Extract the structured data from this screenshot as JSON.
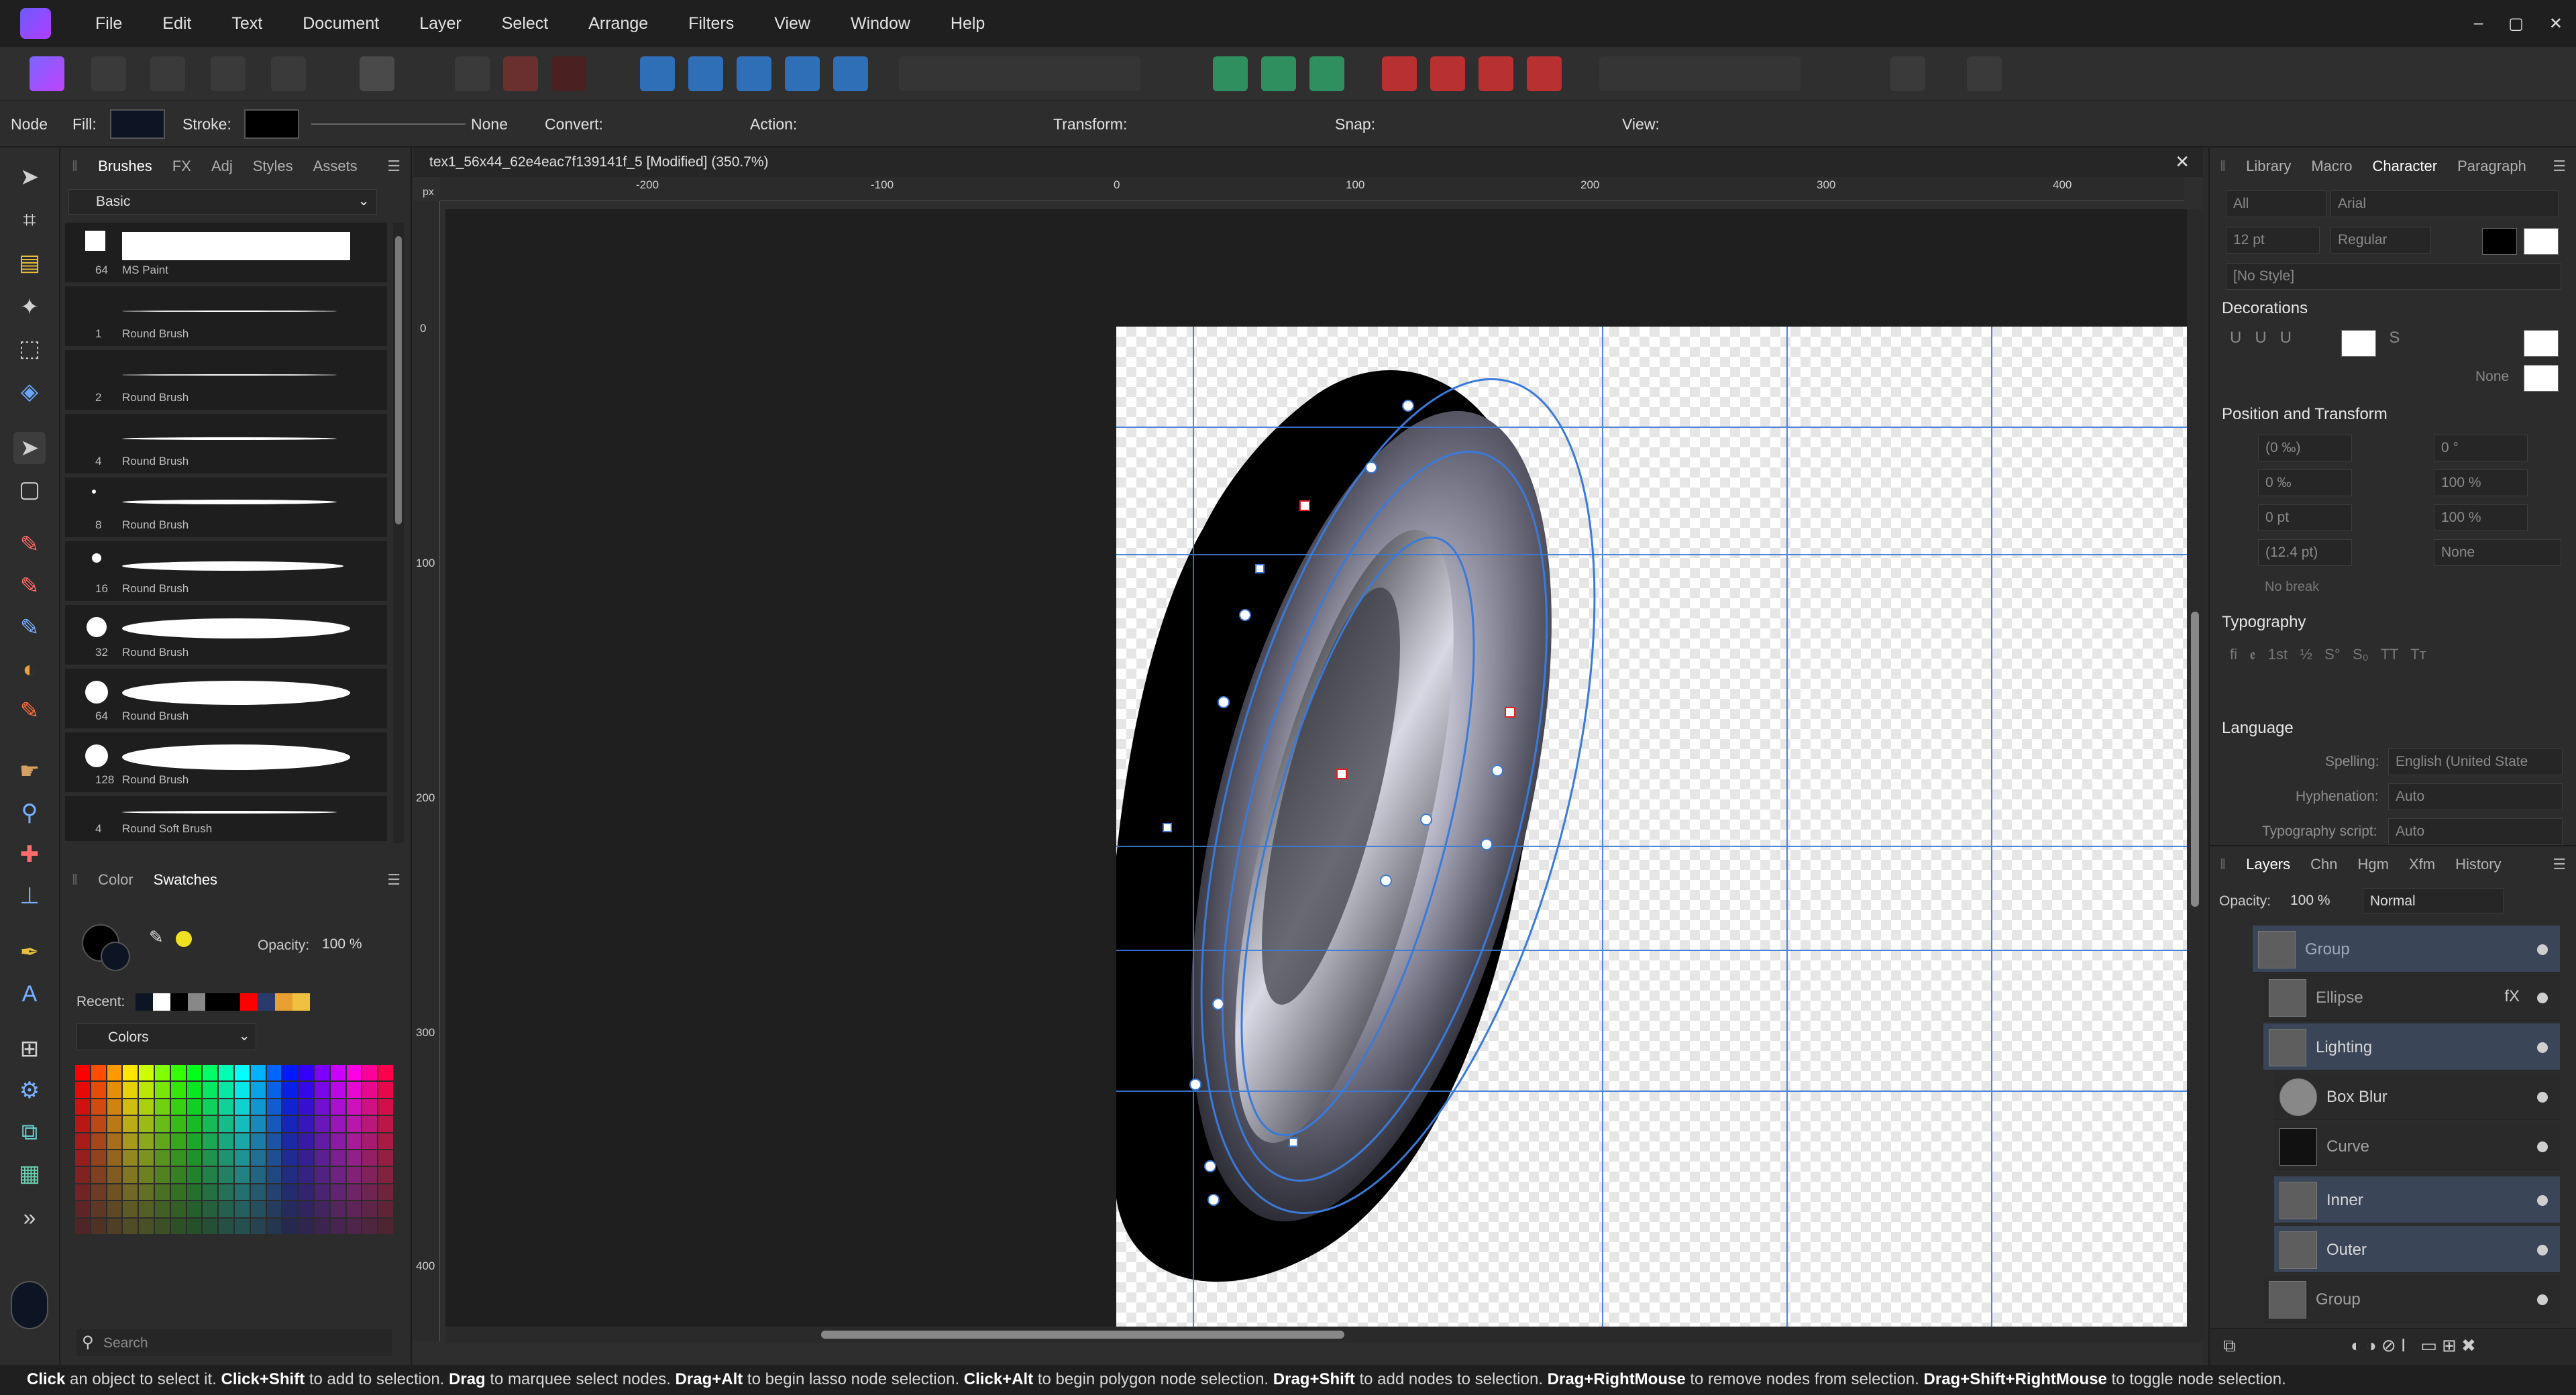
{
  "menubar": {
    "items": [
      "File",
      "Edit",
      "Text",
      "Document",
      "Layer",
      "Select",
      "Arrange",
      "Filters",
      "View",
      "Window",
      "Help"
    ],
    "window_controls": [
      "–",
      "▢",
      "✕"
    ]
  },
  "contextbar": {
    "mode": "Node",
    "fill_label": "Fill:",
    "stroke_label": "Stroke:",
    "stroke_style": "None",
    "convert_label": "Convert:",
    "action_label": "Action:",
    "transform_label": "Transform:",
    "snap_label": "Snap:",
    "view_label": "View:"
  },
  "left_panel": {
    "tabs": [
      "Brushes",
      "FX",
      "Adj",
      "Styles",
      "Assets"
    ],
    "active_tab": "Brushes",
    "category": "Basic",
    "brushes": [
      {
        "size": "64",
        "name": "MS Paint"
      },
      {
        "size": "1",
        "name": "Round Brush"
      },
      {
        "size": "2",
        "name": "Round Brush"
      },
      {
        "size": "4",
        "name": "Round Brush"
      },
      {
        "size": "8",
        "name": "Round Brush"
      },
      {
        "size": "16",
        "name": "Round Brush"
      },
      {
        "size": "32",
        "name": "Round Brush"
      },
      {
        "size": "64",
        "name": "Round Brush"
      },
      {
        "size": "128",
        "name": "Round Brush"
      },
      {
        "size": "4",
        "name": "Round Soft Brush"
      }
    ],
    "color_tabs": [
      "Color",
      "Swatches"
    ],
    "opacity_label": "Opacity:",
    "opacity_value": "100 %",
    "recent_label": "Recent:",
    "palette_name": "Colors",
    "search_placeholder": "Search"
  },
  "document": {
    "title": "tex1_56x44_62e4eac7f139141f_5 [Modified] (350.7%)",
    "ruler_unit": "px",
    "h_ruler": [
      "-200",
      "-100",
      "0",
      "100",
      "200",
      "300",
      "400"
    ],
    "v_ruler": [
      "0",
      "100",
      "200",
      "300",
      "400"
    ]
  },
  "right_panel": {
    "tabs": [
      "Library",
      "Macro",
      "Character",
      "Paragraph"
    ],
    "active_tab": "Character",
    "font_collection": "All",
    "font_family": "Arial",
    "font_size": "12 pt",
    "font_style": "Regular",
    "text_style": "[No Style]",
    "sections": {
      "decorations": "Decorations",
      "position": "Position and Transform",
      "typography": "Typography",
      "language": "Language"
    },
    "decorations_none": "None",
    "pos_fields": {
      "kerning": "(0 ‰)",
      "tracking": "0 ‰",
      "baseline": "0 pt",
      "leading": "(12.4 pt)",
      "italic": "0 °",
      "hscale": "100 %",
      "vscale": "100 %",
      "strike": "None"
    },
    "no_break": "No break",
    "spelling_label": "Spelling:",
    "spelling_value": "English (United State",
    "hyphenation_label": "Hyphenation:",
    "hyphenation_value": "Auto",
    "typo_script_label": "Typography script:",
    "typo_script_value": "Auto"
  },
  "layers_panel": {
    "tabs": [
      "Layers",
      "Chn",
      "Hgm",
      "Xfm",
      "History"
    ],
    "active_tab": "Layers",
    "opacity_label": "Opacity:",
    "opacity_value": "100 %",
    "blend_mode": "Normal",
    "layers": [
      {
        "name": "Group",
        "selected": true
      },
      {
        "name": "Ellipse",
        "selected": false,
        "fx": "fX"
      },
      {
        "name": "Lighting",
        "selected": true
      },
      {
        "name": "Box Blur",
        "selected": false
      },
      {
        "name": "Curve",
        "selected": false
      },
      {
        "name": "Inner",
        "selected": true
      },
      {
        "name": "Outer",
        "selected": true
      },
      {
        "name": "Group",
        "selected": false
      }
    ]
  },
  "statusbar": {
    "parts": [
      [
        "Click",
        " an object to select it. "
      ],
      [
        "Click+Shift",
        " to add to selection. "
      ],
      [
        "Drag",
        " to marquee select nodes. "
      ],
      [
        "Drag+Alt",
        " to begin lasso node selection. "
      ],
      [
        "Click+Alt",
        " to begin polygon node selection. "
      ],
      [
        "Drag+Shift",
        " to add nodes to selection. "
      ],
      [
        "Drag+RightMouse",
        " to remove nodes from selection. "
      ],
      [
        "Drag+Shift+RightMouse",
        " to toggle node selection."
      ]
    ]
  }
}
